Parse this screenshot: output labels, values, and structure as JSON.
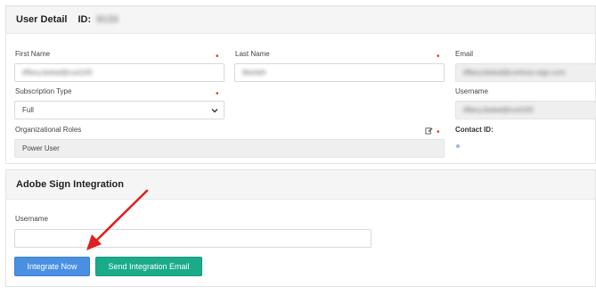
{
  "user_detail": {
    "title": "User Detail",
    "id_label": "ID:",
    "id_value": "9133",
    "first_name": {
      "label": "First Name",
      "value": "tiffany.bisbal@rust100"
    },
    "last_name": {
      "label": "Last Name",
      "value": "Marlath"
    },
    "email": {
      "label": "Email",
      "value": "tiffany.bisbal@contoso-sign.com"
    },
    "subscription_type": {
      "label": "Subscription Type",
      "value": "Full"
    },
    "username": {
      "label": "Username",
      "value": "tiffany.bisbal@rust100"
    },
    "org_roles": {
      "label": "Organizational Roles",
      "value": "Power User"
    },
    "contact_id": {
      "label": "Contact ID:"
    }
  },
  "adobe_sign": {
    "title": "Adobe Sign Integration",
    "username_label": "Username",
    "username_value": "",
    "integrate_button": "Integrate Now",
    "send_email_button": "Send Integration Email"
  },
  "colors": {
    "integrate_button": "#4a90e2",
    "send_email_button": "#1aab8b",
    "required_marker": "#e53935",
    "annotation_arrow": "#e02020"
  },
  "icons": {
    "select_arrow": "chevron-down-icon",
    "edit": "edit-icon",
    "annotation": "red-arrow-annotation"
  }
}
